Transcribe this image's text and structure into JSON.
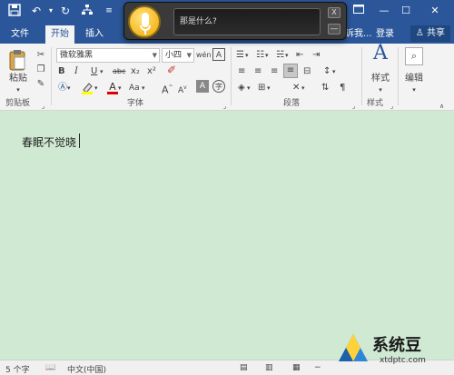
{
  "titlebar": {
    "icons": [
      "save-icon",
      "undo-icon",
      "dropdown-icon",
      "redo-icon",
      "tree-icon",
      "more-icon"
    ],
    "window_controls": [
      "restore-icon",
      "minimize-icon",
      "maximize-icon",
      "close-icon"
    ]
  },
  "tabs": [
    {
      "label": "文件"
    },
    {
      "label": "开始",
      "active": true
    },
    {
      "label": "插入"
    },
    {
      "label": "诉我..."
    }
  ],
  "signin_label": "登录",
  "share_label": "共享",
  "ribbon": {
    "clipboard": {
      "paste_label": "粘贴",
      "group_label": "剪贴板"
    },
    "font": {
      "font_name": "微软雅黑",
      "font_size": "小四",
      "group_label": "字体"
    },
    "paragraph": {
      "group_label": "段落"
    },
    "styles": {
      "styles_label": "样式",
      "group_label": "样式"
    },
    "editing": {
      "editing_label": "编辑"
    }
  },
  "speech": {
    "text": "那是什么?",
    "close_symbol": "X"
  },
  "document": {
    "text": "春眠不觉晓"
  },
  "status": {
    "word_count": "5 个字",
    "language": "中文(中国)"
  },
  "watermark": {
    "name": "系统豆",
    "url": "xtdptc.com"
  },
  "colors": {
    "accent": "#2b579a",
    "doc_background": "#cfe9d3",
    "ribbon": "#f3f3f3"
  }
}
